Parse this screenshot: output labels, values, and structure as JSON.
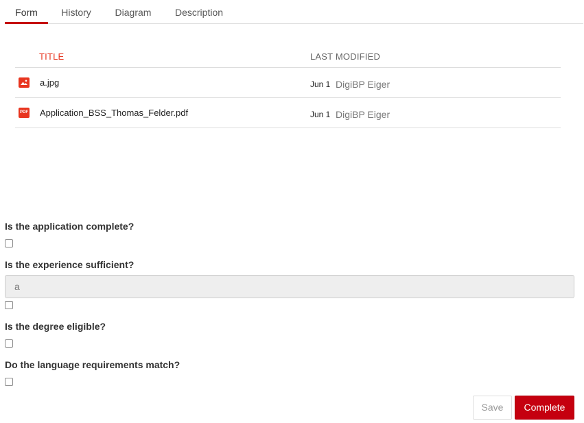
{
  "tabs": {
    "form": "Form",
    "history": "History",
    "diagram": "Diagram",
    "description": "Description",
    "active": "Form"
  },
  "documents": {
    "header": {
      "title": "TITLE",
      "last_modified": "LAST MODIFIED"
    },
    "rows": [
      {
        "icon": "image-file-icon",
        "name": "a.jpg",
        "date": "Jun 1",
        "user": "DigiBP Eiger"
      },
      {
        "icon": "pdf-file-icon",
        "icon_text": "PDF",
        "name": "Application_BSS_Thomas_Felder.pdf",
        "date": "Jun 1",
        "user": "DigiBP Eiger"
      }
    ]
  },
  "form": {
    "q1": {
      "label": "Is the application complete?",
      "checked": false
    },
    "q2": {
      "label": "Is the experience sufficient?",
      "input_value": "a",
      "checked": false
    },
    "q3": {
      "label": "Is the degree eligible?",
      "checked": false
    },
    "q4": {
      "label": "Do the language requirements match?",
      "checked": false
    }
  },
  "actions": {
    "save_label": "Save",
    "complete_label": "Complete"
  },
  "colors": {
    "accent": "#c5000f",
    "header_red": "#e8351f",
    "input_bg": "#eeeeee"
  }
}
